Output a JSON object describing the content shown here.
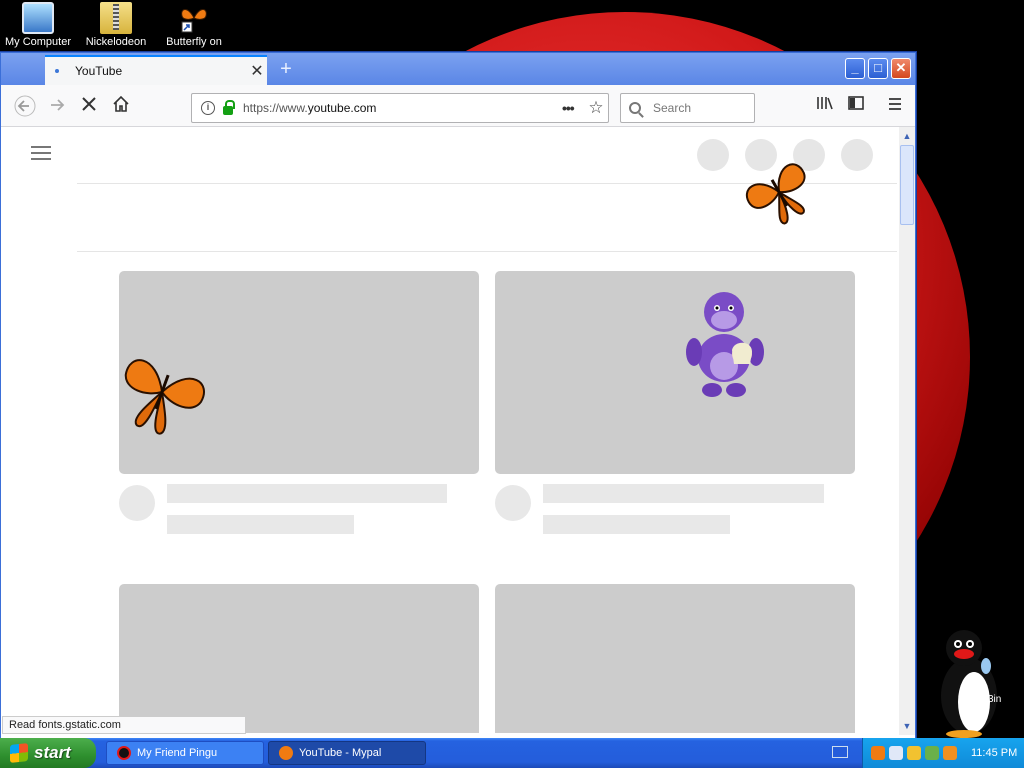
{
  "desktop": {
    "icons": [
      {
        "label": "My Computer",
        "icon": "computer-icon"
      },
      {
        "label": "Nickelodeon",
        "icon": "zip-folder-icon"
      },
      {
        "label": "Butterfly on",
        "icon": "butterfly-shortcut-icon"
      }
    ],
    "pingu_label": "3in"
  },
  "window": {
    "tab_title": "YouTube",
    "url_prefix": "https://www.",
    "url_domain": "youtube.com",
    "search_placeholder": "Search",
    "status_text": "Read fonts.gstatic.com"
  },
  "taskbar": {
    "start_label": "start",
    "tasks": [
      {
        "label": "My Friend Pingu",
        "active": false
      },
      {
        "label": "YouTube - Mypal",
        "active": true
      }
    ],
    "clock": "11:45 PM"
  },
  "colors": {
    "accent_tab": "#0a84ff",
    "lock_green": "#14a014",
    "skeleton": "#cccccc",
    "taskbar": "#245ddb"
  }
}
